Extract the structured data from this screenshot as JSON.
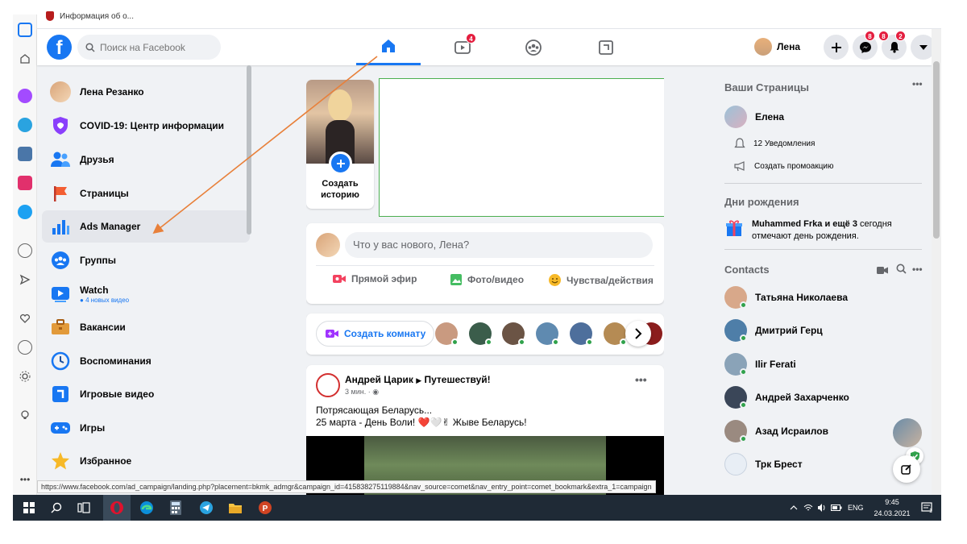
{
  "browser": {
    "tab_title": "Информация об о...",
    "status_url": "https://www.facebook.com/ad_campaign/landing.php?placement=bkmk_admgr&campaign_id=415838275119884&nav_source=comet&nav_entry_point=comet_bookmark&extra_1=campaign"
  },
  "topbar": {
    "logo": "f",
    "search_placeholder": "Поиск на Facebook",
    "watch_badge": "4",
    "profile_name": "Лена",
    "messenger_badge": "8",
    "notifications_badge_a": "8",
    "notifications_badge_b": "2"
  },
  "left_nav": {
    "items": [
      {
        "label": "Лена Резанко",
        "icon": "profile-avatar"
      },
      {
        "label": "COVID-19: Центр информации",
        "icon": "covid-shield-icon"
      },
      {
        "label": "Друзья",
        "icon": "friends-icon"
      },
      {
        "label": "Страницы",
        "icon": "pages-flag-icon"
      },
      {
        "label": "Ads Manager",
        "icon": "ads-manager-icon"
      },
      {
        "label": "Группы",
        "icon": "groups-icon"
      },
      {
        "label": "Watch",
        "icon": "watch-icon",
        "sub": "4 новых видео"
      },
      {
        "label": "Вакансии",
        "icon": "jobs-briefcase-icon"
      },
      {
        "label": "Воспоминания",
        "icon": "memories-clock-icon"
      },
      {
        "label": "Игровые видео",
        "icon": "gaming-video-icon"
      },
      {
        "label": "Игры",
        "icon": "games-controller-icon"
      },
      {
        "label": "Избранное",
        "icon": "favorites-star-icon"
      }
    ]
  },
  "feed": {
    "story_create_label": "Создать историю",
    "composer_placeholder": "Что у вас нового, Лена?",
    "composer_actions": [
      "Прямой эфир",
      "Фото/видео",
      "Чувства/действия"
    ],
    "create_room": "Создать комнату",
    "post": {
      "author": "Андрей Царик",
      "target": "Путешествуй!",
      "time": "3 мин. ·",
      "line1": "Потрясающая Беларусь...",
      "line2": "25 марта - День Воли! ❤️🤍✌ Жыве Беларусь!"
    }
  },
  "right": {
    "pages_title": "Ваши Страницы",
    "page_name": "Елена",
    "notifications": "12 Уведомления",
    "promo": "Создать промоакцию",
    "birthdays_title": "Дни рождения",
    "birthday_name": "Muhammed Frka и ещё 3",
    "birthday_rest": " сегодня",
    "birthday_line2": "отмечают день рождения.",
    "contacts_title": "Contacts",
    "contacts": [
      "Татьяна Николаева",
      "Дмитрий Герц",
      "Ilir Ferati",
      "Андрей Захарченко",
      "Азад Исраилов",
      "Трк Брест"
    ]
  },
  "taskbar": {
    "lang": "ENG",
    "time": "9:45",
    "date": "24.03.2021"
  },
  "colors": {
    "brand": "#1877f2",
    "badge": "#e41e3f",
    "online": "#31a24c",
    "annotation_arrow": "#e8803a"
  }
}
